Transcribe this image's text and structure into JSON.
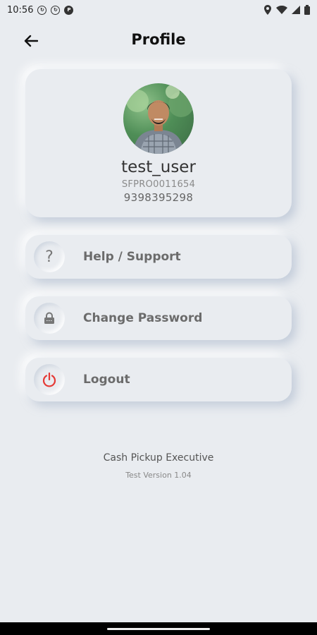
{
  "status_bar": {
    "time": "10:56",
    "notification_icons": [
      "sync-icon",
      "sync-icon",
      "pinterest-icon"
    ],
    "right_icons": [
      "location-icon",
      "wifi-icon",
      "signal-icon",
      "battery-icon"
    ]
  },
  "header": {
    "title": "Profile",
    "back_icon": "arrow-left-icon"
  },
  "profile": {
    "username": "test_user",
    "user_id": "SFPRO0011654",
    "phone": "9398395298"
  },
  "menu": {
    "items": [
      {
        "label": "Help / Support",
        "icon": "question-icon"
      },
      {
        "label": "Change Password",
        "icon": "lock-icon"
      },
      {
        "label": "Logout",
        "icon": "power-icon",
        "icon_color": "#e53935"
      }
    ]
  },
  "footer": {
    "app_name": "Cash Pickup Executive",
    "version": "Test Version 1.04"
  },
  "colors": {
    "background": "#e9ecf0",
    "logout_accent": "#e53935"
  }
}
